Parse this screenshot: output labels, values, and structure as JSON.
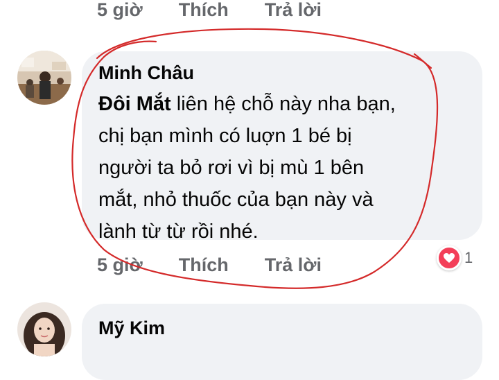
{
  "top_actions": {
    "time": "5 giờ",
    "like": "Thích",
    "reply": "Trả lời"
  },
  "comment1": {
    "author": "Minh Châu",
    "mention": "Đôi Mắt",
    "lines": [
      " liên hệ chỗ này nha bạn,",
      "chị bạn mình có luợn 1 bé bị",
      "người ta bỏ rơi vì bị mù 1 bên",
      "mắt, nhỏ thuốc của bạn này và",
      "lành từ từ rồi nhé."
    ],
    "time": "5 giờ",
    "like": "Thích",
    "reply": "Trả lời",
    "reaction_icon": "heart-reaction-icon",
    "reaction_count": "1"
  },
  "comment2": {
    "author": "Mỹ Kim"
  },
  "colors": {
    "bubble": "#f0f2f5",
    "action_text": "#65676b",
    "annotation_red": "#d42a2a",
    "reaction_heart": "#f33e58"
  }
}
